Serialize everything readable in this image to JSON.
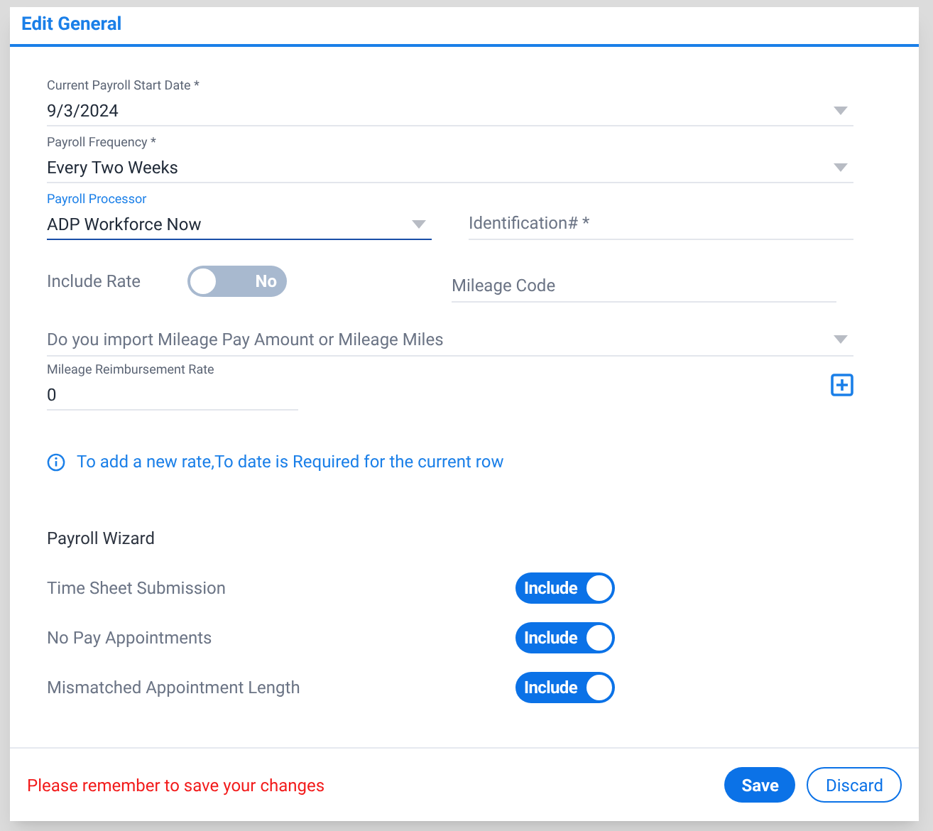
{
  "dialog": {
    "title": "Edit General"
  },
  "start_date": {
    "label": "Current Payroll Start Date *",
    "value": "9/3/2024"
  },
  "frequency": {
    "label": "Payroll Frequency *",
    "value": "Every Two Weeks"
  },
  "processor": {
    "label": "Payroll Processor",
    "value": "ADP Workforce Now",
    "focused": true
  },
  "identification": {
    "placeholder": "Identification# *"
  },
  "include_rate": {
    "label": "Include Rate",
    "on": false,
    "toggle_text": "No"
  },
  "mileage_code": {
    "placeholder": "Mileage Code"
  },
  "mileage_import": {
    "placeholder": "Do you import Mileage Pay Amount or Mileage Miles"
  },
  "reimbursement_rate": {
    "label": "Mileage Reimbursement Rate",
    "value": "0"
  },
  "info_note": "To add a new rate,To date is Required for the current row",
  "wizard": {
    "title": "Payroll Wizard",
    "items": [
      {
        "label": "Time Sheet Submission",
        "on": true,
        "toggle_text": "Include"
      },
      {
        "label": "No Pay Appointments",
        "on": true,
        "toggle_text": "Include"
      },
      {
        "label": "Mismatched Appointment Length",
        "on": true,
        "toggle_text": "Include"
      }
    ]
  },
  "footer": {
    "message": "Please remember to save your changes",
    "buttons": [
      {
        "label": "Save",
        "kind": "primary"
      },
      {
        "label": "Discard",
        "kind": "outline"
      }
    ]
  }
}
